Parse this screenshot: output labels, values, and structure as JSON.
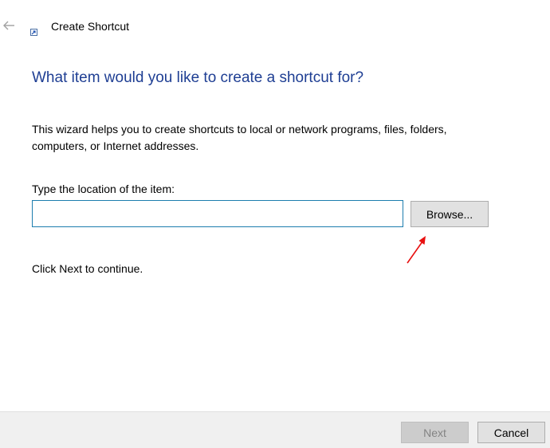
{
  "header": {
    "back_icon": "back-arrow-icon",
    "app_icon": "shortcut-icon",
    "title": "Create Shortcut"
  },
  "main": {
    "heading": "What item would you like to create a shortcut for?",
    "description": "This wizard helps you to create shortcuts to local or network programs, files, folders, computers, or Internet addresses.",
    "location_label": "Type the location of the item:",
    "location_value": "",
    "location_placeholder": "",
    "browse_label": "Browse...",
    "continue_text": "Click Next to continue.",
    "annotation_icon": "red-arrow-icon"
  },
  "footer": {
    "next_label": "Next",
    "next_enabled": false,
    "cancel_label": "Cancel"
  },
  "colors": {
    "heading": "#1e3e93",
    "input_border": "#1c7dae",
    "annotation": "#e81010",
    "footer_bg": "#f0f0f0",
    "disabled_text": "#838383"
  }
}
